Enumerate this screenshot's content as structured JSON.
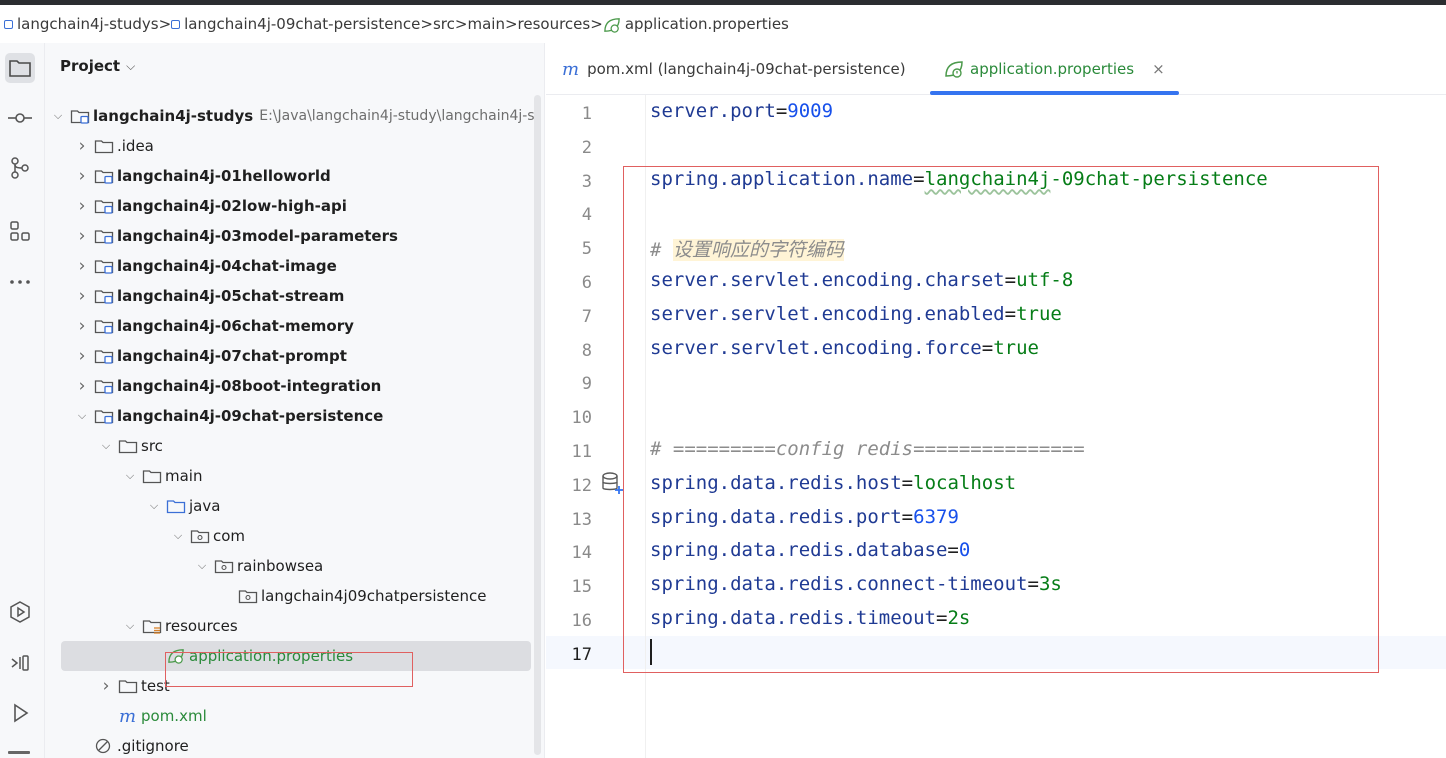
{
  "breadcrumb": [
    {
      "label": "langchain4j-studys",
      "icon": "module-icon"
    },
    {
      "label": "langchain4j-09chat-persistence",
      "icon": "module-icon"
    },
    {
      "label": "src",
      "icon": ""
    },
    {
      "label": "main",
      "icon": ""
    },
    {
      "label": "resources",
      "icon": ""
    },
    {
      "label": "application.properties",
      "icon": "spring-leaf-icon"
    }
  ],
  "breadcrumb_separator": ">",
  "project_panel": {
    "title": "Project",
    "tree": [
      {
        "label": "langchain4j-studys",
        "path": "E:\\Java\\langchain4j-study\\langchain4j-stu",
        "depth": 0,
        "expanded": true,
        "icon": "module-folder-icon",
        "bold": true
      },
      {
        "label": ".idea",
        "depth": 1,
        "expanded": false,
        "icon": "folder-icon"
      },
      {
        "label": "langchain4j-01helloworld",
        "depth": 1,
        "expanded": false,
        "icon": "module-folder-icon",
        "bold": true
      },
      {
        "label": "langchain4j-02low-high-api",
        "depth": 1,
        "expanded": false,
        "icon": "module-folder-icon",
        "bold": true
      },
      {
        "label": "langchain4j-03model-parameters",
        "depth": 1,
        "expanded": false,
        "icon": "module-folder-icon",
        "bold": true
      },
      {
        "label": "langchain4j-04chat-image",
        "depth": 1,
        "expanded": false,
        "icon": "module-folder-icon",
        "bold": true
      },
      {
        "label": "langchain4j-05chat-stream",
        "depth": 1,
        "expanded": false,
        "icon": "module-folder-icon",
        "bold": true
      },
      {
        "label": "langchain4j-06chat-memory",
        "depth": 1,
        "expanded": false,
        "icon": "module-folder-icon",
        "bold": true
      },
      {
        "label": "langchain4j-07chat-prompt",
        "depth": 1,
        "expanded": false,
        "icon": "module-folder-icon",
        "bold": true
      },
      {
        "label": "langchain4j-08boot-integration",
        "depth": 1,
        "expanded": false,
        "icon": "module-folder-icon",
        "bold": true
      },
      {
        "label": "langchain4j-09chat-persistence",
        "depth": 1,
        "expanded": true,
        "icon": "module-folder-icon",
        "bold": true
      },
      {
        "label": "src",
        "depth": 2,
        "expanded": true,
        "icon": "folder-icon"
      },
      {
        "label": "main",
        "depth": 3,
        "expanded": true,
        "icon": "folder-icon"
      },
      {
        "label": "java",
        "depth": 4,
        "expanded": true,
        "icon": "source-folder-icon"
      },
      {
        "label": "com",
        "depth": 5,
        "expanded": true,
        "icon": "package-icon"
      },
      {
        "label": "rainbowsea",
        "depth": 6,
        "expanded": true,
        "icon": "package-icon"
      },
      {
        "label": "langchain4j09chatpersistence",
        "depth": 7,
        "expanded": null,
        "icon": "package-icon"
      },
      {
        "label": "resources",
        "depth": 3,
        "expanded": true,
        "icon": "resources-folder-icon"
      },
      {
        "label": "application.properties",
        "depth": 4,
        "expanded": null,
        "icon": "spring-leaf-icon",
        "green": true,
        "selected": true
      },
      {
        "label": "test",
        "depth": 2,
        "expanded": false,
        "icon": "folder-icon"
      },
      {
        "label": "pom.xml",
        "depth": 2,
        "expanded": null,
        "icon": "maven-icon",
        "green": true
      },
      {
        "label": ".gitignore",
        "depth": 1,
        "expanded": null,
        "icon": "ignore-icon"
      }
    ]
  },
  "tool_window": [
    {
      "name": "project-tool-icon",
      "active": true
    },
    {
      "name": "commit-tool-icon",
      "active": false
    },
    {
      "name": "git-tool-icon",
      "active": false
    },
    {
      "name": "structure-tool-icon",
      "active": false
    },
    {
      "name": "more-tools-icon",
      "active": false
    },
    {
      "name": "services-tool-icon",
      "active": false
    },
    {
      "name": "terminal-tool-icon",
      "active": false
    },
    {
      "name": "run-tool-icon",
      "active": false
    }
  ],
  "editor": {
    "tabs": [
      {
        "label": "pom.xml (langchain4j-09chat-persistence)",
        "icon": "maven-icon",
        "active": false
      },
      {
        "label": "application.properties",
        "icon": "spring-leaf-icon",
        "active": true,
        "close": "×"
      }
    ],
    "current_line": 17,
    "lines": [
      {
        "n": "1",
        "segs": [
          {
            "t": "server.port",
            "c": "k"
          },
          {
            "t": "=",
            "c": "eq"
          },
          {
            "t": "9009",
            "c": "v-num"
          }
        ]
      },
      {
        "n": "2",
        "segs": []
      },
      {
        "n": "3",
        "segs": [
          {
            "t": "spring.application.name",
            "c": "k"
          },
          {
            "t": "=",
            "c": "eq"
          },
          {
            "t": "langchain4j",
            "c": "v-str wavy"
          },
          {
            "t": "-09chat-persistence",
            "c": "v-str"
          }
        ]
      },
      {
        "n": "4",
        "segs": []
      },
      {
        "n": "5",
        "segs": [
          {
            "t": "# ",
            "c": "cmt"
          },
          {
            "t": "设置响应的字符编码",
            "c": "cmt cmt-cn"
          }
        ]
      },
      {
        "n": "6",
        "segs": [
          {
            "t": "server.servlet.encoding.charset",
            "c": "k"
          },
          {
            "t": "=",
            "c": "eq"
          },
          {
            "t": "utf-8",
            "c": "v-str"
          }
        ]
      },
      {
        "n": "7",
        "segs": [
          {
            "t": "server.servlet.encoding.enabled",
            "c": "k"
          },
          {
            "t": "=",
            "c": "eq"
          },
          {
            "t": "true",
            "c": "v-kw"
          }
        ]
      },
      {
        "n": "8",
        "segs": [
          {
            "t": "server.servlet.encoding.force",
            "c": "k"
          },
          {
            "t": "=",
            "c": "eq"
          },
          {
            "t": "true",
            "c": "v-kw"
          }
        ]
      },
      {
        "n": "9",
        "segs": []
      },
      {
        "n": "10",
        "segs": []
      },
      {
        "n": "11",
        "segs": [
          {
            "t": "# =========config redis===============",
            "c": "cmt"
          }
        ]
      },
      {
        "n": "12",
        "segs": [
          {
            "t": "spring.data.redis.host",
            "c": "k"
          },
          {
            "t": "=",
            "c": "eq"
          },
          {
            "t": "localhost",
            "c": "v-str"
          }
        ]
      },
      {
        "n": "13",
        "segs": [
          {
            "t": "spring.data.redis.port",
            "c": "k"
          },
          {
            "t": "=",
            "c": "eq"
          },
          {
            "t": "6379",
            "c": "v-num"
          }
        ]
      },
      {
        "n": "14",
        "segs": [
          {
            "t": "spring.data.redis.database",
            "c": "k"
          },
          {
            "t": "=",
            "c": "eq"
          },
          {
            "t": "0",
            "c": "v-num"
          }
        ]
      },
      {
        "n": "15",
        "segs": [
          {
            "t": "spring.data.redis.connect-timeout",
            "c": "k"
          },
          {
            "t": "=",
            "c": "eq"
          },
          {
            "t": "3s",
            "c": "v-str"
          }
        ]
      },
      {
        "n": "16",
        "segs": [
          {
            "t": "spring.data.redis.timeout",
            "c": "k"
          },
          {
            "t": "=",
            "c": "eq"
          },
          {
            "t": "2s",
            "c": "v-str"
          }
        ]
      },
      {
        "n": "17",
        "segs": []
      }
    ]
  },
  "colors": {
    "accent": "#3574f0",
    "annotation": "#e06060",
    "key": "#1f3a93",
    "string_value": "#067d17",
    "number_value": "#1750eb",
    "comment": "#8c8c8c"
  }
}
